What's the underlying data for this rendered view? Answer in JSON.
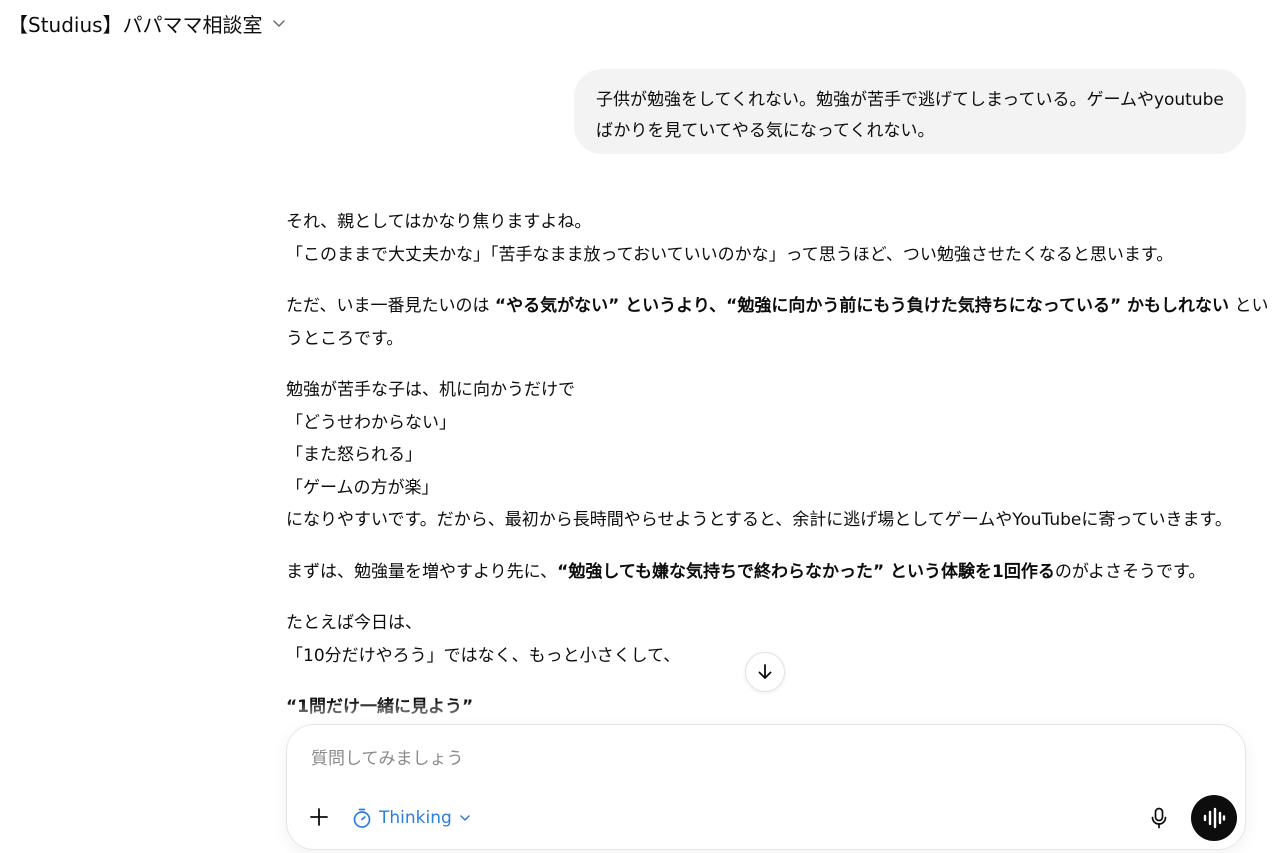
{
  "header": {
    "title": "【Studius】パパママ相談室"
  },
  "user_message": {
    "lines": [
      "子供が勉強をしてくれない。勉強が苦手で逃げてしまっている。ゲームやyoutube",
      "ばかりを見ていてやる気になってくれない。"
    ]
  },
  "assistant": {
    "p1": {
      "line1": "それ、親としてはかなり焦りますよね。",
      "line2": "「このままで大丈夫かな」「苦手なまま放っておいていいのかな」って思うほど、つい勉強させたくなると思います。"
    },
    "p2": {
      "pre": "ただ、いま一番見たいのは ",
      "bold1": "“やる気がない” というより、“勉強に向かう前にもう負けた気持ちになっている” かもしれない",
      "post": " とい",
      "line2": "うところです。"
    },
    "p3": {
      "lines": [
        "勉強が苦手な子は、机に向かうだけで",
        "「どうせわからない」",
        "「また怒られる」",
        "「ゲームの方が楽」",
        "になりやすいです。だから、最初から長時間やらせようとすると、余計に逃げ場としてゲームやYouTubeに寄っていきます。"
      ]
    },
    "p4": {
      "pre": "まずは、勉強量を増やすより先に、",
      "bold1": "“勉強しても嫌な気持ちで終わらなかった” という体験を1回作る",
      "post": "のがよさそうです。"
    },
    "p5": {
      "line1": "たとえば今日は、",
      "line2": "「10分だけやろう」ではなく、もっと小さくして、"
    },
    "p6": {
      "bold": "“1問だけ一緒に見よう”"
    }
  },
  "composer": {
    "placeholder": "質問してみましょう",
    "mode_label": "Thinking",
    "add_icon": "plus-icon",
    "mode_icon": "timer-icon",
    "mic_icon": "microphone-icon",
    "voice_icon": "voice-waveform-icon"
  },
  "colors": {
    "accent": "#2b7de0",
    "bubble": "#f3f3f3",
    "text": "#0d0d0d",
    "placeholder": "#8a8a8a"
  }
}
